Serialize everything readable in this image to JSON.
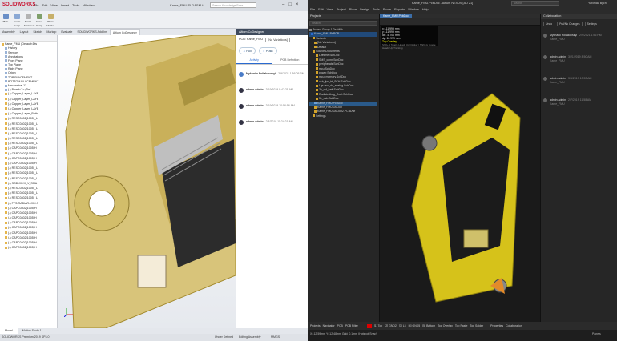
{
  "solidworks": {
    "logo": "SOLIDWORKS",
    "menu": [
      "File",
      "Edit",
      "View",
      "Insert",
      "Tools",
      "Window"
    ],
    "doc_title": "Kame_FMU.SLDASM *",
    "search_placeholder": "Search Knowledge Base",
    "tabs": [
      "Assembly",
      "Layout",
      "Sketch",
      "Markup",
      "Evaluate",
      "SOLIDWORKS Add-Ins",
      "Altium CoDesigner"
    ],
    "active_tab": "Altium CoDesigner",
    "toolbar_buttons": [
      "Mate",
      "Linear Comp",
      "Smart Fasteners",
      "Move Comp",
      "Show Hidden"
    ],
    "tree_root": "Kame_FMU (Default<Dis",
    "tree_top": [
      "History",
      "Sensors",
      "Annotations",
      "Front Plane",
      "Top Plane",
      "Right Plane",
      "Origin",
      "TOP PLACEMENT",
      "BOTTOM PLACEMENT",
      "Mechanical 13",
      "(-) Board<7> (Def"
    ],
    "tree_parts": [
      "(-) Copper_Layer_LAYE",
      "(-) Copper_Layer_LAYE",
      "(-) Copper_Layer_LAYE",
      "(-) Copper_Layer_LAYE",
      "(-) Copper_Layer_Botto",
      "(-) RESC0402(1005)_L",
      "(-) RESC0402(1005)_L",
      "(-) RESC0402(1005)_L",
      "(-) RESC0402(1005)_L",
      "(-) RESC0402(1005)_L",
      "(-) RESC0402(1005)_L",
      "(-) CAPC0402(1005)H",
      "(-) CAPC0402(1005)H",
      "(-) CAPC0402(1005)H",
      "(-) CAPC0402(1005)H",
      "(-) RESC0402(1005)_L",
      "(-) RESC0402(1005)_L",
      "(-) RESC0402(1005)_L",
      "(-) SODXXXX_V_SMA",
      "(-) RESC0402(1005)_L",
      "(-) RESC0402(1005)_L",
      "(-) RESC0402(1005)_L",
      "(-) FTS-RADIAR-XXX-S",
      "(-) CAPC0402(1005)H",
      "(-) CAPC0402(1005)H",
      "(-) CAPC0402(1005)H",
      "(-) CAPC0402(1005)H",
      "(-) CAPC0402(1005)H",
      "(-) CAPC0402(1005)H",
      "(-) CAPC0402(1005)H",
      "(-) CAPC0402(1005)H",
      "(-) CAPC0402(1005)H"
    ],
    "bottom_tabs": [
      "Model",
      "Motion Study 1"
    ],
    "status_left": "SOLIDWORKS Premium 2019 SP3.0",
    "status_right": [
      "Under Defined",
      "Editing Assembly",
      "MMGS"
    ],
    "panel_title": "Altium CoDesigner",
    "pcb_label": "PCB: Kame_FMU",
    "pcb_variation": "[No Variations]",
    "pull_label": "Pull",
    "push_label": "Push",
    "panel_tabs": [
      "Activity",
      "PCB Definition"
    ],
    "activity": [
      {
        "user": "Mykhailo Poliakovskyi",
        "date": "2/9/2021 1:56:05 PM"
      },
      {
        "user": "admin admin",
        "date": "3/19/2019 8:42:25 AM"
      },
      {
        "user": "admin admin",
        "date": "3/19/2019 10:56:56 AM"
      },
      {
        "user": "admin admin",
        "date": "2/8/2019 11:24:21 AM"
      }
    ]
  },
  "altium": {
    "menu": [
      "File",
      "Edit",
      "View",
      "Project",
      "Place",
      "Design",
      "Tools",
      "Route",
      "Reports",
      "Window",
      "Help"
    ],
    "title": "Kame_FMU.PcbDoc - Altium NEXUS [AD 21]",
    "search_placeholder": "Search",
    "user": "Yaroslav Bych",
    "projects_panel": "Projects",
    "projects_search": "Search",
    "project_group": "Project Group 1.DsnWrk",
    "project_root": "Kame_FMU.PrjPCB",
    "tree": [
      "Variants",
      "[No Variations]",
      "Default",
      "Source Documents",
      "Settings",
      "Kame_FMU.PcbDoc",
      "Kame_FMU.OutJob",
      "Kame_FMU.OutJob2.PCBDwf"
    ],
    "schematics": [
      "Lifetime.SchDoc",
      "SMS_conn.SchDoc",
      "peripherals.SchDoc",
      "mcu.SchDoc",
      "power.SchDoc",
      "mcu_memory.SchDoc",
      "usb_fpc_bt_SCH.SchDoc",
      "Lgs.ucc_dc_analog.SchDoc",
      "3v_ref_batt.SchDoc",
      "Radiatedbug_Cont.SchDoc",
      "5v_usb.SchDoc"
    ],
    "doc_tab": "Kame_FMU.PcbDoc",
    "coords": [
      "x: -11.999 mm",
      "y: -11.999 mm",
      "dx: -6.700 mm",
      "dy: 12.999 mm"
    ],
    "layer_info": "Top Overlay",
    "hint": "Shift+H Toggle Heads Up Display / Shift+G Toggle Heads Up Tracking",
    "collab_title": "Collaboration",
    "collab_buttons": [
      "Undo",
      "Pull/No Changes",
      "Settings"
    ],
    "collab_items": [
      {
        "user": "Mykhailo Poliakovskyi",
        "date": "2/9/2021 1:56 PM",
        "detail": "Kame_FMU"
      },
      {
        "user": "admin admin",
        "date": "3/21/2019 8:50 AM",
        "detail": "Kame_FMU"
      },
      {
        "user": "admin admin",
        "date": "3/6/2019 10:53 AM",
        "detail": "Kame_FMU"
      },
      {
        "user": "admin admin",
        "date": "2/7/2019 11:58 AM",
        "detail": "Kame_FMU"
      }
    ],
    "bottom_tabs": [
      "Projects",
      "Navigator",
      "PCB",
      "PCB Filter"
    ],
    "layers": [
      "[1] Top",
      "[2] GND2",
      "[3] L3",
      "[4] GND5",
      "[5] Bottom",
      "Top Overlay",
      "Top Paste",
      "Top Solder"
    ],
    "right_tabs": [
      "Properties",
      "Collaboration"
    ],
    "status": "X:-12.59mm Y:-12.48mm  Grid: 0.1mm  (Hotspot Snap)",
    "panels_btn": "Panels"
  }
}
